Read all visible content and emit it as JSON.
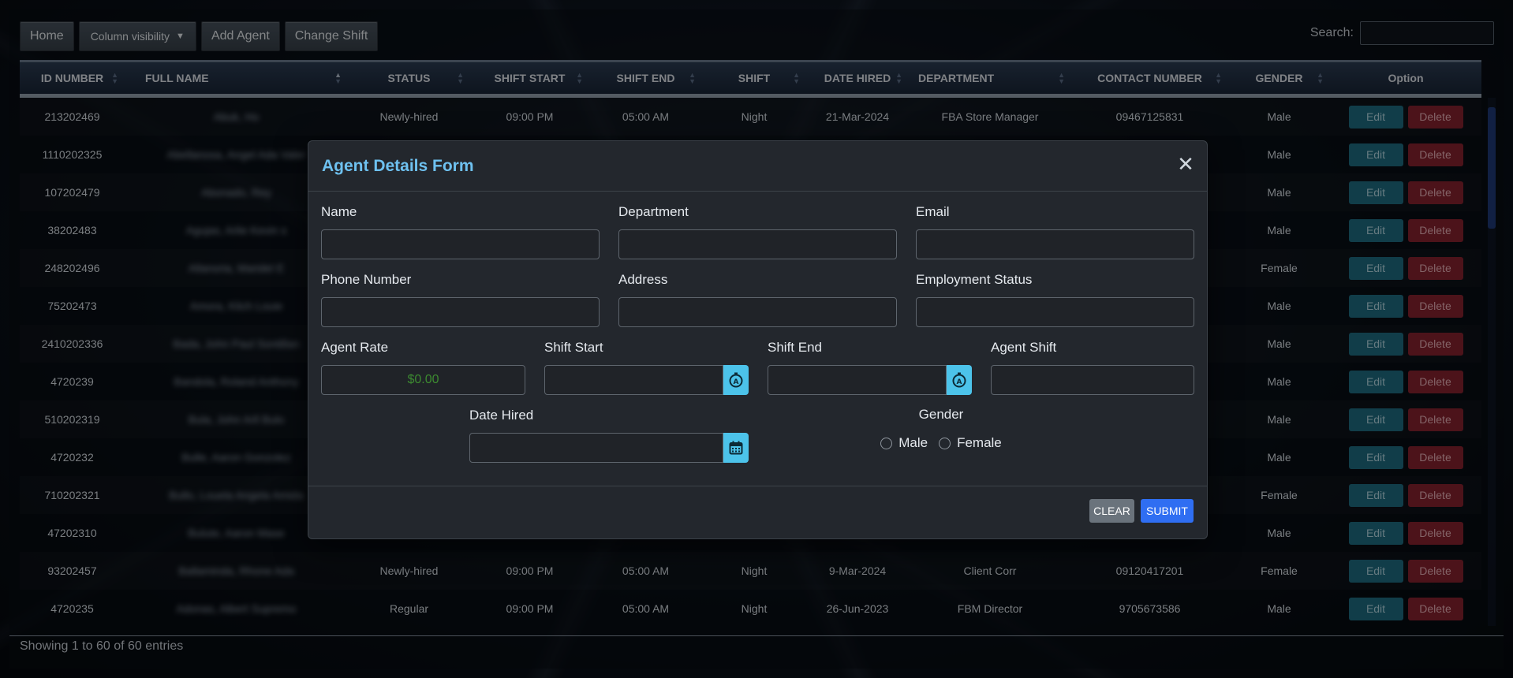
{
  "toolbar": {
    "home": "Home",
    "column_visibility": "Column visibility",
    "add_agent": "Add Agent",
    "change_shift": "Change Shift"
  },
  "search": {
    "label": "Search:",
    "value": ""
  },
  "table": {
    "headers": [
      "ID NUMBER",
      "FULL NAME",
      "STATUS",
      "SHIFT START",
      "SHIFT END",
      "SHIFT",
      "DATE HIRED",
      "DEPARTMENT",
      "CONTACT NUMBER",
      "GENDER",
      "Option"
    ],
    "edit_label": "Edit",
    "delete_label": "Delete",
    "rows": [
      {
        "id": "213202469",
        "name": "Abuk, Ho",
        "status": "Newly-hired",
        "shift_start": "09:00 PM",
        "shift_end": "05:00 AM",
        "shift": "Night",
        "date_hired": "21-Mar-2024",
        "department": "FBA Store Manager",
        "contact": "09467125831",
        "gender": "Male"
      },
      {
        "id": "1110202325",
        "name": "Abellanosa, Angel Ada Valer",
        "status": "",
        "shift_start": "",
        "shift_end": "",
        "shift": "",
        "date_hired": "",
        "department": "",
        "contact": "",
        "gender": "Male"
      },
      {
        "id": "107202479",
        "name": "Abonado, Rey",
        "status": "",
        "shift_start": "",
        "shift_end": "",
        "shift": "",
        "date_hired": "",
        "department": "",
        "contact": "",
        "gender": "Male"
      },
      {
        "id": "38202483",
        "name": "Agujas, Arlie Kevin s",
        "status": "",
        "shift_start": "",
        "shift_end": "",
        "shift": "",
        "date_hired": "",
        "department": "",
        "contact": "",
        "gender": "Male"
      },
      {
        "id": "248202496",
        "name": "Allanoria, Maridel E",
        "status": "",
        "shift_start": "",
        "shift_end": "",
        "shift": "",
        "date_hired": "",
        "department": "",
        "contact": "",
        "gender": "Female"
      },
      {
        "id": "75202473",
        "name": "Amora, Klich Louie",
        "status": "",
        "shift_start": "",
        "shift_end": "",
        "shift": "",
        "date_hired": "",
        "department": "",
        "contact": "",
        "gender": "Male"
      },
      {
        "id": "2410202336",
        "name": "Bada, John Paul Sontillan",
        "status": "",
        "shift_start": "",
        "shift_end": "",
        "shift": "",
        "date_hired": "",
        "department": "",
        "contact": "",
        "gender": "Male"
      },
      {
        "id": "4720239",
        "name": "Bandola, Roland Anthony",
        "status": "",
        "shift_start": "",
        "shift_end": "",
        "shift": "",
        "date_hired": "",
        "department": "",
        "contact": "",
        "gender": "Male"
      },
      {
        "id": "510202319",
        "name": "Bula, John Arll Bulo",
        "status": "",
        "shift_start": "",
        "shift_end": "",
        "shift": "",
        "date_hired": "",
        "department": "",
        "contact": "",
        "gender": "Male"
      },
      {
        "id": "4720232",
        "name": "Bulle, Aaron Gonzolez",
        "status": "",
        "shift_start": "",
        "shift_end": "",
        "shift": "",
        "date_hired": "",
        "department": "",
        "contact": "",
        "gender": "Male"
      },
      {
        "id": "710202321",
        "name": "Bullo, Louela Angela Amida",
        "status": "",
        "shift_start": "",
        "shift_end": "",
        "shift": "",
        "date_hired": "",
        "department": "",
        "contact": "",
        "gender": "Female"
      },
      {
        "id": "47202310",
        "name": "Bulute, Aaron Mase",
        "status": "",
        "shift_start": "",
        "shift_end": "",
        "shift": "",
        "date_hired": "",
        "department": "",
        "contact": "",
        "gender": "Male"
      },
      {
        "id": "93202457",
        "name": "Ballaminda, Rhone Ada",
        "status": "Newly-hired",
        "shift_start": "09:00 PM",
        "shift_end": "05:00 AM",
        "shift": "Night",
        "date_hired": "9-Mar-2024",
        "department": "Client Corr",
        "contact": "09120417201",
        "gender": "Female"
      },
      {
        "id": "4720235",
        "name": "Adonas, Albert Supremo",
        "status": "Regular",
        "shift_start": "09:00 PM",
        "shift_end": "05:00 AM",
        "shift": "Night",
        "date_hired": "26-Jun-2023",
        "department": "FBM Director",
        "contact": "9705673586",
        "gender": "Male"
      }
    ]
  },
  "info": "Showing 1 to 60 of 60 entries",
  "modal": {
    "title": "Agent Details Form",
    "labels": {
      "name": "Name",
      "department": "Department",
      "email": "Email",
      "phone": "Phone Number",
      "address": "Address",
      "employment_status": "Employment Status",
      "agent_rate": "Agent Rate",
      "shift_start": "Shift Start",
      "shift_end": "Shift End",
      "agent_shift": "Agent Shift",
      "date_hired": "Date Hired",
      "gender": "Gender",
      "male": "Male",
      "female": "Female"
    },
    "values": {
      "agent_rate": "$0.00"
    },
    "clear": "CLEAR",
    "submit": "SUBMIT"
  }
}
